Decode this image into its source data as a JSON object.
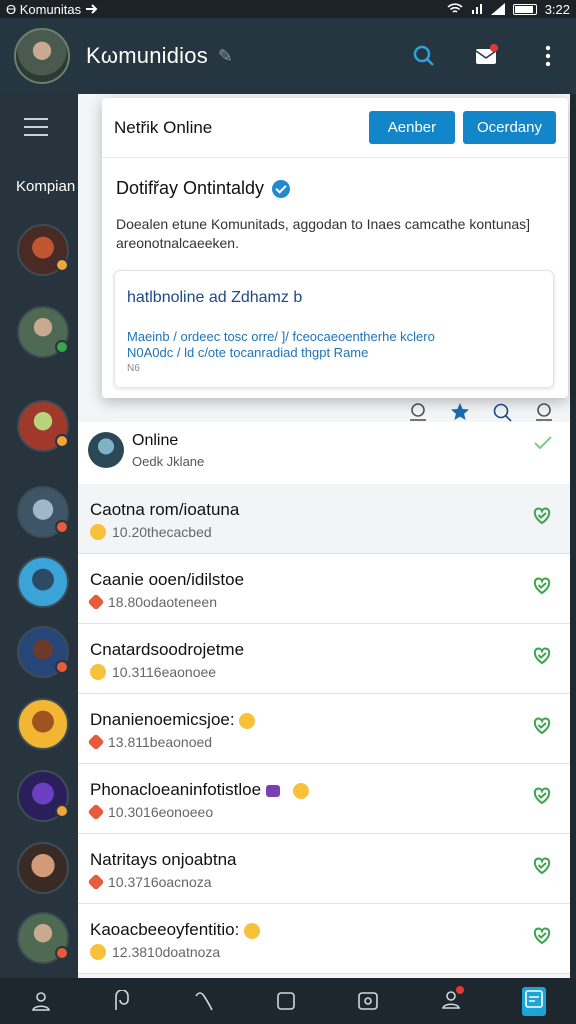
{
  "status": {
    "left_text": "Ɵ Komunitas",
    "time": "3:22"
  },
  "appbar": {
    "title": "Kωmunidios",
    "pin": "✎"
  },
  "rail": {
    "label": "Kompian"
  },
  "card": {
    "header_title": "Netřik Online",
    "btn_primary": "Aenber",
    "btn_secondary": "Ocerdany",
    "subtitle": "Dotifřay Ontintaldy",
    "description": "Doealen etune Komunitads, aggodan to Inaes camcathe kontunas] areonotnalcaeeken.",
    "inner": {
      "heading": "hatlbnoline ad Zdhamz b",
      "line1": "Maeinb / ordeec tosc orre/ ]/ fceocaeoentherhe kclero",
      "line2": "N0A0dc / ld c/ote tocanradiad thgpt Rame",
      "line3": "N6"
    }
  },
  "online": {
    "name": "Online",
    "meta": "Oedk Jklane"
  },
  "rows": [
    {
      "name": "Caotna rom/ioatuna",
      "meta": "10.20thecacbed",
      "emoji": "y"
    },
    {
      "name": "Caanie ooen/idilstoe",
      "meta": "18.80odaoteneen",
      "emoji": "r"
    },
    {
      "name": "Cnatardsoodrojetme",
      "meta": "10.3116eaonoee",
      "emoji": "y"
    },
    {
      "name": "Dnanienoemicsjoe:",
      "meta": "13.811beaonoed",
      "emoji": "r"
    },
    {
      "name": "Phonacloeaninfotistloe",
      "meta": "10.3016eonoeeo",
      "emoji": "r"
    },
    {
      "name": "Natritays onjoabtna",
      "meta": "10.3716oacnoza",
      "emoji": "r"
    },
    {
      "name": "Kaoacbeeoyfentitio:",
      "meta": "12.3810doatnoza",
      "emoji": "y"
    }
  ],
  "colors": {
    "accent": "#1286c8",
    "check": "#3aa54b",
    "rail": "#27343d"
  },
  "icons": [
    "search-icon",
    "notification-icon",
    "more-vert-icon",
    "menu-icon",
    "check-icon"
  ]
}
